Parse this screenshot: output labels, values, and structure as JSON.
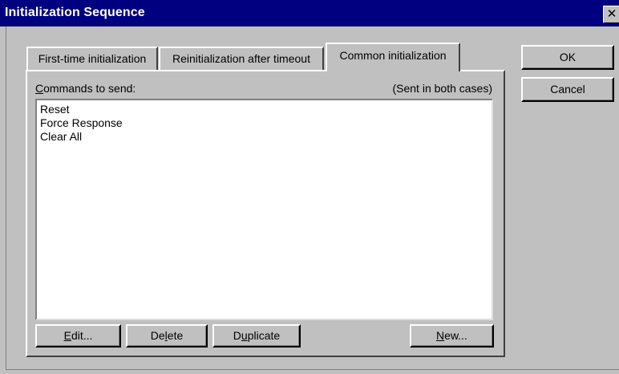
{
  "window": {
    "title": "Initialization Sequence",
    "close_glyph": "✕"
  },
  "tabs": [
    {
      "label": "First-time initialization",
      "selected": false
    },
    {
      "label": "Reinitialization after timeout",
      "selected": false
    },
    {
      "label": "Common initialization",
      "selected": true
    }
  ],
  "panel": {
    "commands_label_first": "C",
    "commands_label_rest": "ommands to send:",
    "sent_note": "(Sent in both cases)",
    "commands": [
      "Reset",
      "Force Response",
      "Clear All"
    ]
  },
  "buttons": {
    "edit_u": "E",
    "edit_rest": "dit...",
    "delete_pre": "De",
    "delete_u": "l",
    "delete_post": "ete",
    "duplicate_pre": "D",
    "duplicate_u": "u",
    "duplicate_post": "plicate",
    "new_u": "N",
    "new_rest": "ew...",
    "ok": "OK",
    "cancel": "Cancel"
  },
  "colors": {
    "titlebar": "#000080",
    "face": "#c0c0c0",
    "list_bg": "#ffffff"
  }
}
